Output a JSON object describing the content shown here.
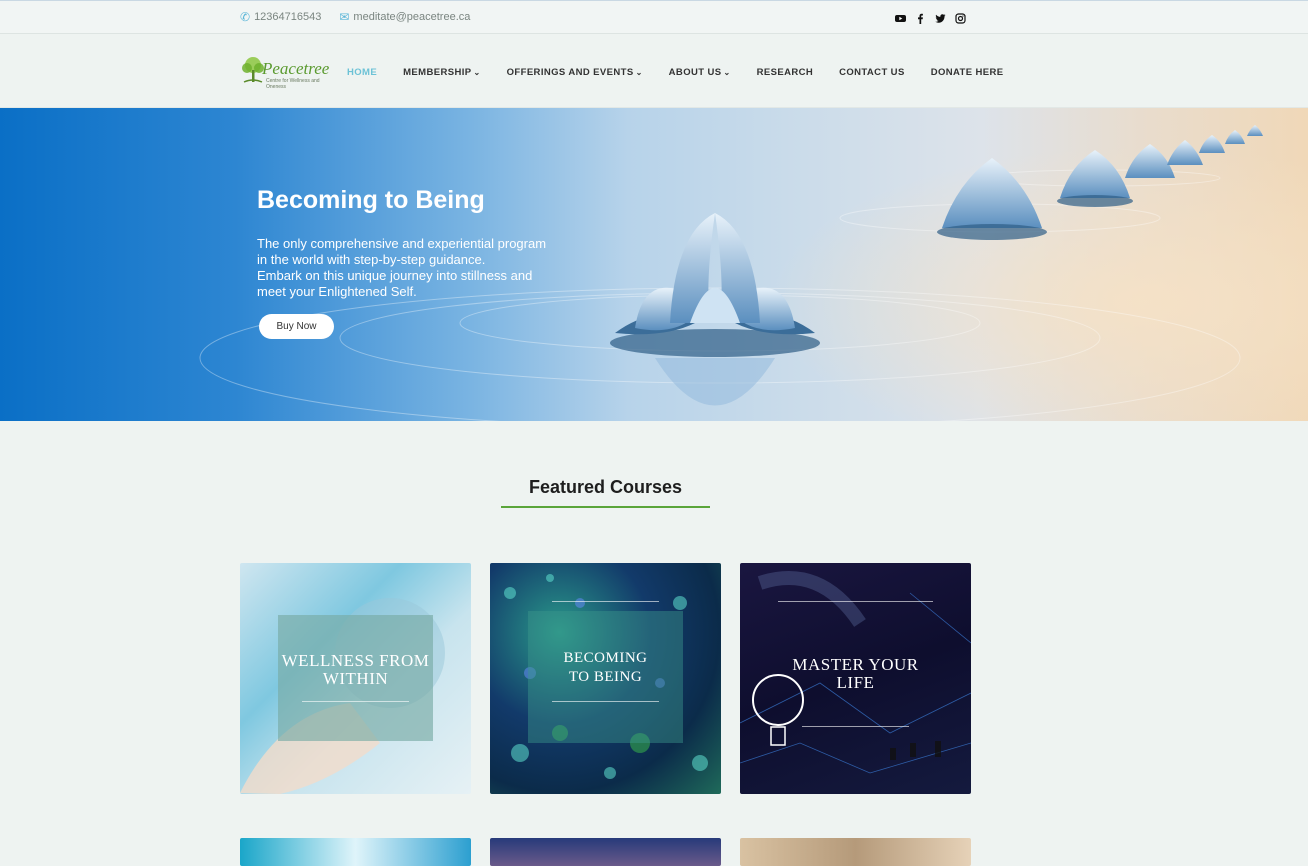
{
  "topbar": {
    "phone": "12364716543",
    "email": "meditate@peacetree.ca",
    "social": [
      "youtube-icon",
      "facebook-icon",
      "twitter-icon",
      "instagram-icon"
    ]
  },
  "brand": {
    "name": "Peacetree",
    "tagline": "Centre for Wellness and Oneness"
  },
  "menu": [
    {
      "label": "HOME",
      "active": true
    },
    {
      "label": "MEMBERSHIP",
      "dropdown": true
    },
    {
      "label": "OFFERINGS AND EVENTS",
      "dropdown": true
    },
    {
      "label": "ABOUT US",
      "dropdown": true
    },
    {
      "label": "RESEARCH"
    },
    {
      "label": "CONTACT US"
    },
    {
      "label": "DONATE HERE"
    }
  ],
  "hero": {
    "title": "Becoming to Being",
    "lines": [
      "The only comprehensive and experiential program",
      "in the world with step-by-step guidance.",
      "Embark on this unique journey into stillness and",
      "meet your Enlightened Self."
    ],
    "button": "Buy Now"
  },
  "featured": {
    "title": "Featured Courses",
    "courses": [
      {
        "line1": "WELLNESS FROM",
        "line2": "WITHIN"
      },
      {
        "line1": "BECOMING",
        "line2": "TO BEING"
      },
      {
        "line1": "MASTER YOUR",
        "line2": "LIFE"
      }
    ]
  },
  "colors": {
    "accent": "#6cc2d6",
    "brand_green": "#5aa53a",
    "hero_blue": "#0a6fc6"
  }
}
